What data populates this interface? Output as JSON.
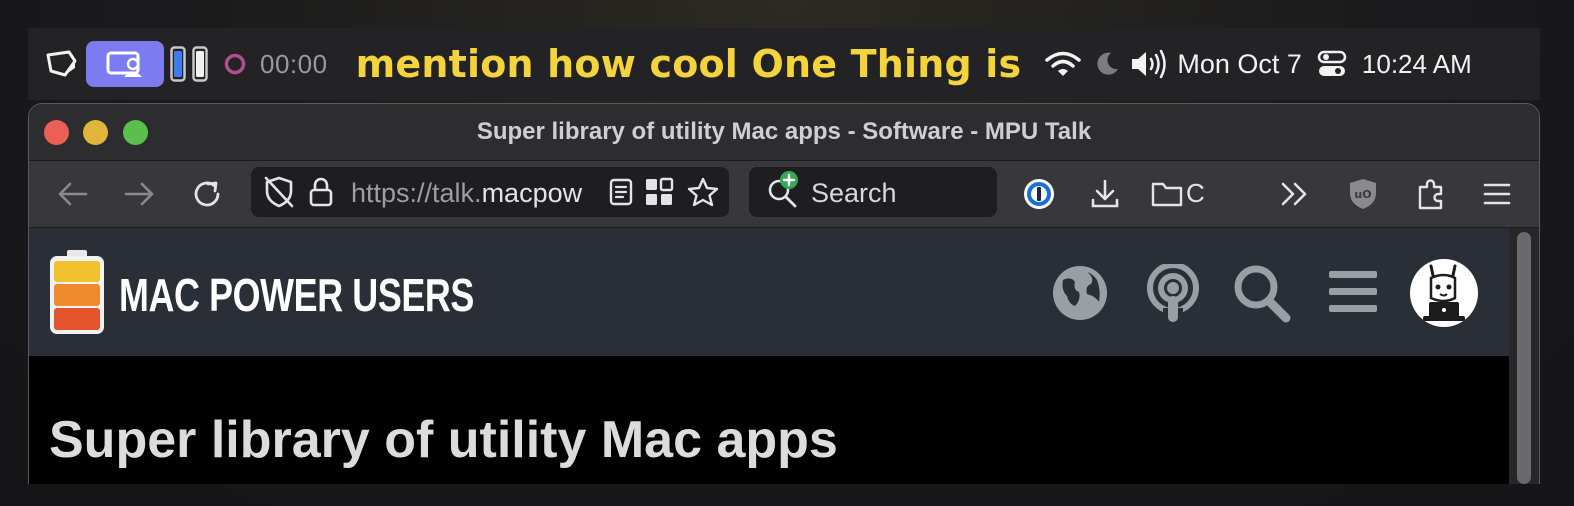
{
  "menubar": {
    "timer": "00:00",
    "one_thing": "mention how cool One Thing is",
    "date": "Mon Oct 7",
    "time": "10:24 AM",
    "accent_pill_color": "#7a7cf0",
    "one_thing_color": "#f4d43c"
  },
  "window": {
    "title": "Super library of utility Mac apps - Software - MPU Talk"
  },
  "toolbar": {
    "url_prefix": "https://talk.",
    "url_host": "macpow",
    "search_placeholder": "Search",
    "folder_label": "C"
  },
  "site": {
    "logo_text": "MAC POWER USERS",
    "topic_title": "Super library of utility Mac apps"
  }
}
